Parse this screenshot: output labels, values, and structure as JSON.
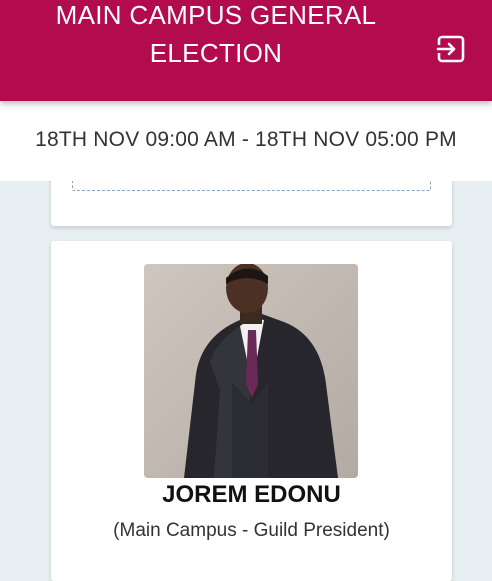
{
  "header": {
    "title_line1": "MAIN CAMPUS GENERAL",
    "title_line2": "ELECTION",
    "exit_icon": "exit-to-app-icon",
    "color": "#b20c4f"
  },
  "schedule": {
    "text": "18TH NOV 09:00 AM - 18TH NOV 05:00 PM"
  },
  "candidate": {
    "name": "JOREM EDONU",
    "position": "(Main Campus - Guild President)"
  }
}
